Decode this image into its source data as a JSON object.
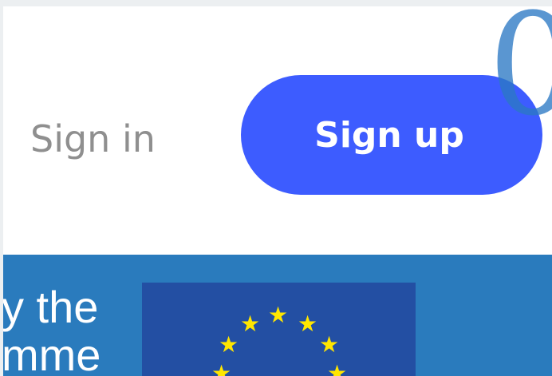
{
  "header": {
    "sign_in_label": "Sign in",
    "sign_up_label": "Sign up",
    "badge_digit": "0",
    "accent_color": "#3d5cff",
    "sign_in_color": "#8f8f8f"
  },
  "banner": {
    "background_color": "#2a7bbd",
    "text_line_1": "y the",
    "text_line_2": "mme",
    "flag_icon": "eu-flag-icon",
    "flag_background": "#234fa3",
    "star_color": "#ffe600",
    "star_glyph": "★"
  }
}
